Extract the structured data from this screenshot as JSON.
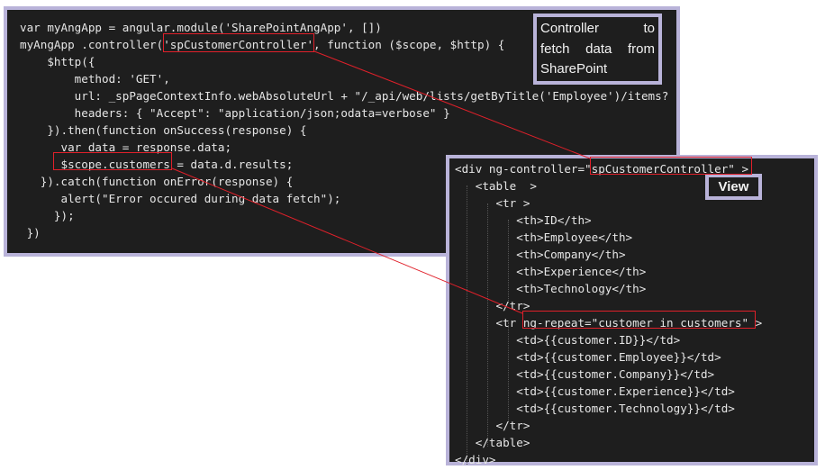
{
  "controller_code": [
    "var myAngApp = angular.module('SharePointAngApp', [])",
    "myAngApp .controller('spCustomerController', function ($scope, $http) {",
    "    $http({",
    "        method: 'GET',",
    "        url: _spPageContextInfo.webAbsoluteUrl + \"/_api/web/lists/getByTitle('Employee')/items?",
    "        headers: { \"Accept\": \"application/json;odata=verbose\" }",
    "    }).then(function onSuccess(response) {",
    "      var data = response.data;",
    "      $scope.customers = data.d.results;",
    "   }).catch(function onError(response) {",
    "      alert(\"Error occured during data fetch\");",
    "     });",
    " })"
  ],
  "view_code": [
    "<div ng-controller=\"spCustomerController\" >",
    "   <table  >",
    "      <tr >",
    "         <th>ID</th>",
    "         <th>Employee</th>",
    "         <th>Company</th>",
    "         <th>Experience</th>",
    "         <th>Technology</th>",
    "      </tr>",
    "      <tr ng-repeat=\"customer in customers\" >",
    "         <td>{{customer.ID}}</td>",
    "         <td>{{customer.Employee}}</td>",
    "         <td>{{customer.Company}}</td>",
    "         <td>{{customer.Experience}}</td>",
    "         <td>{{customer.Technology}}</td>",
    "      </tr>",
    "   </table>",
    "</div>"
  ],
  "controller_note": {
    "line1_word1": "Controller",
    "line1_word2": "to",
    "line2_word1": "fetch",
    "line2_word2": "data",
    "line2_word3": "from",
    "line3": "SharePoint"
  },
  "view_label": "View",
  "colors": {
    "panel_background": "#1e1e1e",
    "panel_border": "#b9b3d9",
    "code_text": "#e6e6e6",
    "highlight": "#e0202a"
  }
}
